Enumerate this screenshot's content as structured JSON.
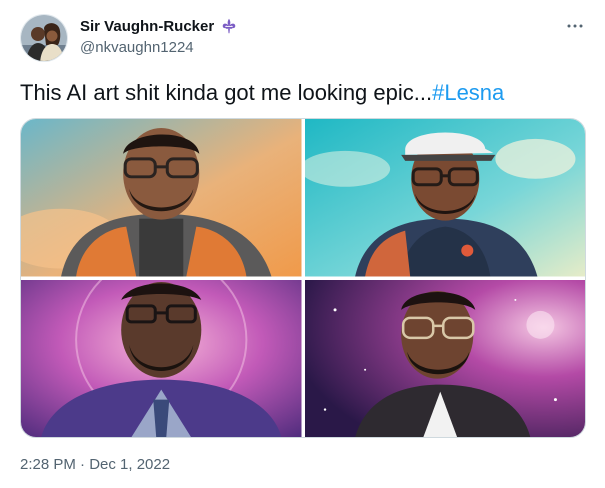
{
  "author": {
    "display_name": "Sir Vaughn-Rucker",
    "handle": "@nkvaughn1224",
    "badge_icon": "fleur-de-lis-icon",
    "badge_color": "#7b5cc4"
  },
  "tweet": {
    "text": "This AI art shit kinda got me looking epic...",
    "hashtag": "#Lesna",
    "hashtag_color": "#1d9bf0",
    "timestamp": "2:28 PM · Dec 1, 2022"
  },
  "media": {
    "image_count": 4
  },
  "more_icon": "more-dots-icon"
}
